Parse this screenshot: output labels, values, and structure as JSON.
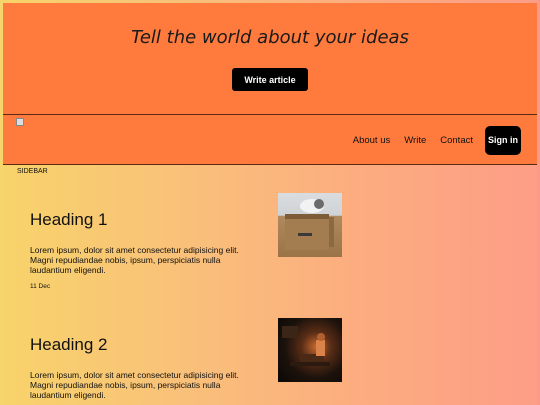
{
  "hero": {
    "title": "Tell the world about your ideas",
    "cta_label": "Write article"
  },
  "navbar": {
    "links": [
      "About us",
      "Write",
      "Contact"
    ],
    "signin_label": "Sign in"
  },
  "sidebar": {
    "label": "SIDEBAR"
  },
  "posts": [
    {
      "heading": "Heading 1",
      "excerpt": "Lorem ipsum, dolor sit amet consectetur adipisicing elit. Magni repudiandae nobis, ipsum, perspiciatis nulla laudantium eligendi.",
      "date": "11 Dec",
      "image": "cat-in-box"
    },
    {
      "heading": "Heading 2",
      "excerpt": "Lorem ipsum, dolor sit amet consectetur adipisicing elit. Magni repudiandae nobis, ipsum, perspiciatis nulla laudantium eligendi.",
      "image": "dim-room"
    }
  ],
  "colors": {
    "accent": "#ff7a3d",
    "button": "#000000"
  }
}
